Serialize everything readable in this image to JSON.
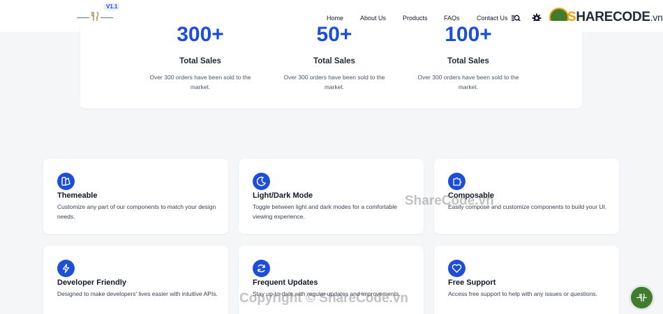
{
  "header": {
    "version": "V1.1",
    "nav": [
      "Home",
      "About Us",
      "Products",
      "FAQs",
      "Contact Us"
    ],
    "icons": [
      "search-icon",
      "gear-icon"
    ]
  },
  "brand": {
    "text_main": "HARECODE",
    "text_s": "S",
    "text_tld": ".vn"
  },
  "stats": [
    {
      "value": "300+",
      "title": "Total Sales",
      "desc": "Over 300 orders have been sold to the market."
    },
    {
      "value": "50+",
      "title": "Total Sales",
      "desc": "Over 300 orders have been sold to the market."
    },
    {
      "value": "100+",
      "title": "Total Sales",
      "desc": "Over 300 orders have been sold to the market."
    }
  ],
  "features": [
    {
      "icon": "palette-icon",
      "title": "Themeable",
      "desc": "Customize any part of our components to match your design needs."
    },
    {
      "icon": "moon-icon",
      "title": "Light/Dark Mode",
      "desc": "Toggle between light and dark modes for a comfortable viewing experience."
    },
    {
      "icon": "puzzle-icon",
      "title": "Composable",
      "desc": "Easily compose and customize components to build your UI."
    },
    {
      "icon": "bolt-icon",
      "title": "Developer Friendly",
      "desc": "Designed to make developers' lives easier with intuitive APIs."
    },
    {
      "icon": "refresh-icon",
      "title": "Frequent Updates",
      "desc": "Stay up-to-date with regular updates and improvements."
    },
    {
      "icon": "heart-icon",
      "title": "Free Support",
      "desc": "Access free support to help with any issues or questions."
    }
  ],
  "watermarks": {
    "center": "ShareCode.vn",
    "bottom": "Copyright © ShareCode.vn"
  },
  "colors": {
    "accent": "#1d4ed8",
    "brand_green": "#3f7d2c",
    "brand_orange": "#f59e0b"
  }
}
